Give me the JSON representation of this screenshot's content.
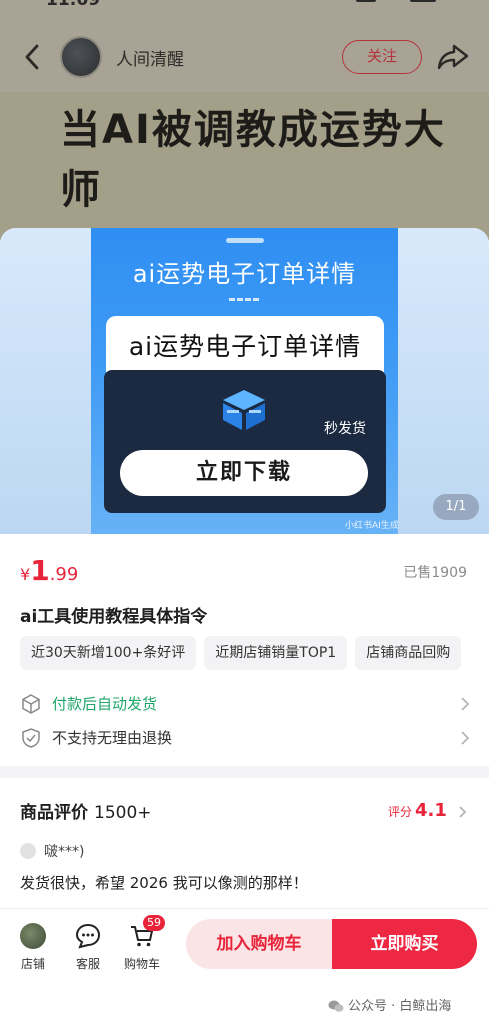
{
  "status_bar": {
    "time": "11:09"
  },
  "note": {
    "author": "人间清醒",
    "follow_label": "关注",
    "headline": "当AI被调教成运势大师"
  },
  "banner": {
    "top_title": "ai运势电子订单详情",
    "card_title": "ai运势电子订单详情",
    "fast_ship": "秒发货",
    "download_label": "立即下载",
    "watermark": "小红书AI生成",
    "pager": "1/1"
  },
  "product": {
    "currency": "¥",
    "price_int": "1",
    "price_dec": ".99",
    "sold": "已售1909",
    "name": "ai工具使用教程具体指令",
    "tags": [
      "近30天新增100+条好评",
      "近期店铺销量TOP1",
      "店铺商品回购"
    ],
    "ship_text": "付款后自动发货",
    "return_text": "不支持无理由退换"
  },
  "reviews": {
    "title": "商品评价",
    "count": "1500+",
    "score_label": "评分",
    "score_value": "4.1",
    "user": "啵***)",
    "text": "发货很快，希望 2026 我可以像测的那样！"
  },
  "bottom_bar": {
    "shop_label": "店铺",
    "service_label": "客服",
    "cart_label": "购物车",
    "cart_badge": "59",
    "add_cart_label": "加入购物车",
    "buy_label": "立即购买"
  },
  "watermark_wechat": "公众号 · 白鲸出海",
  "colors": {
    "accent_red": "#e8243a",
    "ship_green": "#20a66a",
    "banner_blue": "#2f8ef2"
  }
}
